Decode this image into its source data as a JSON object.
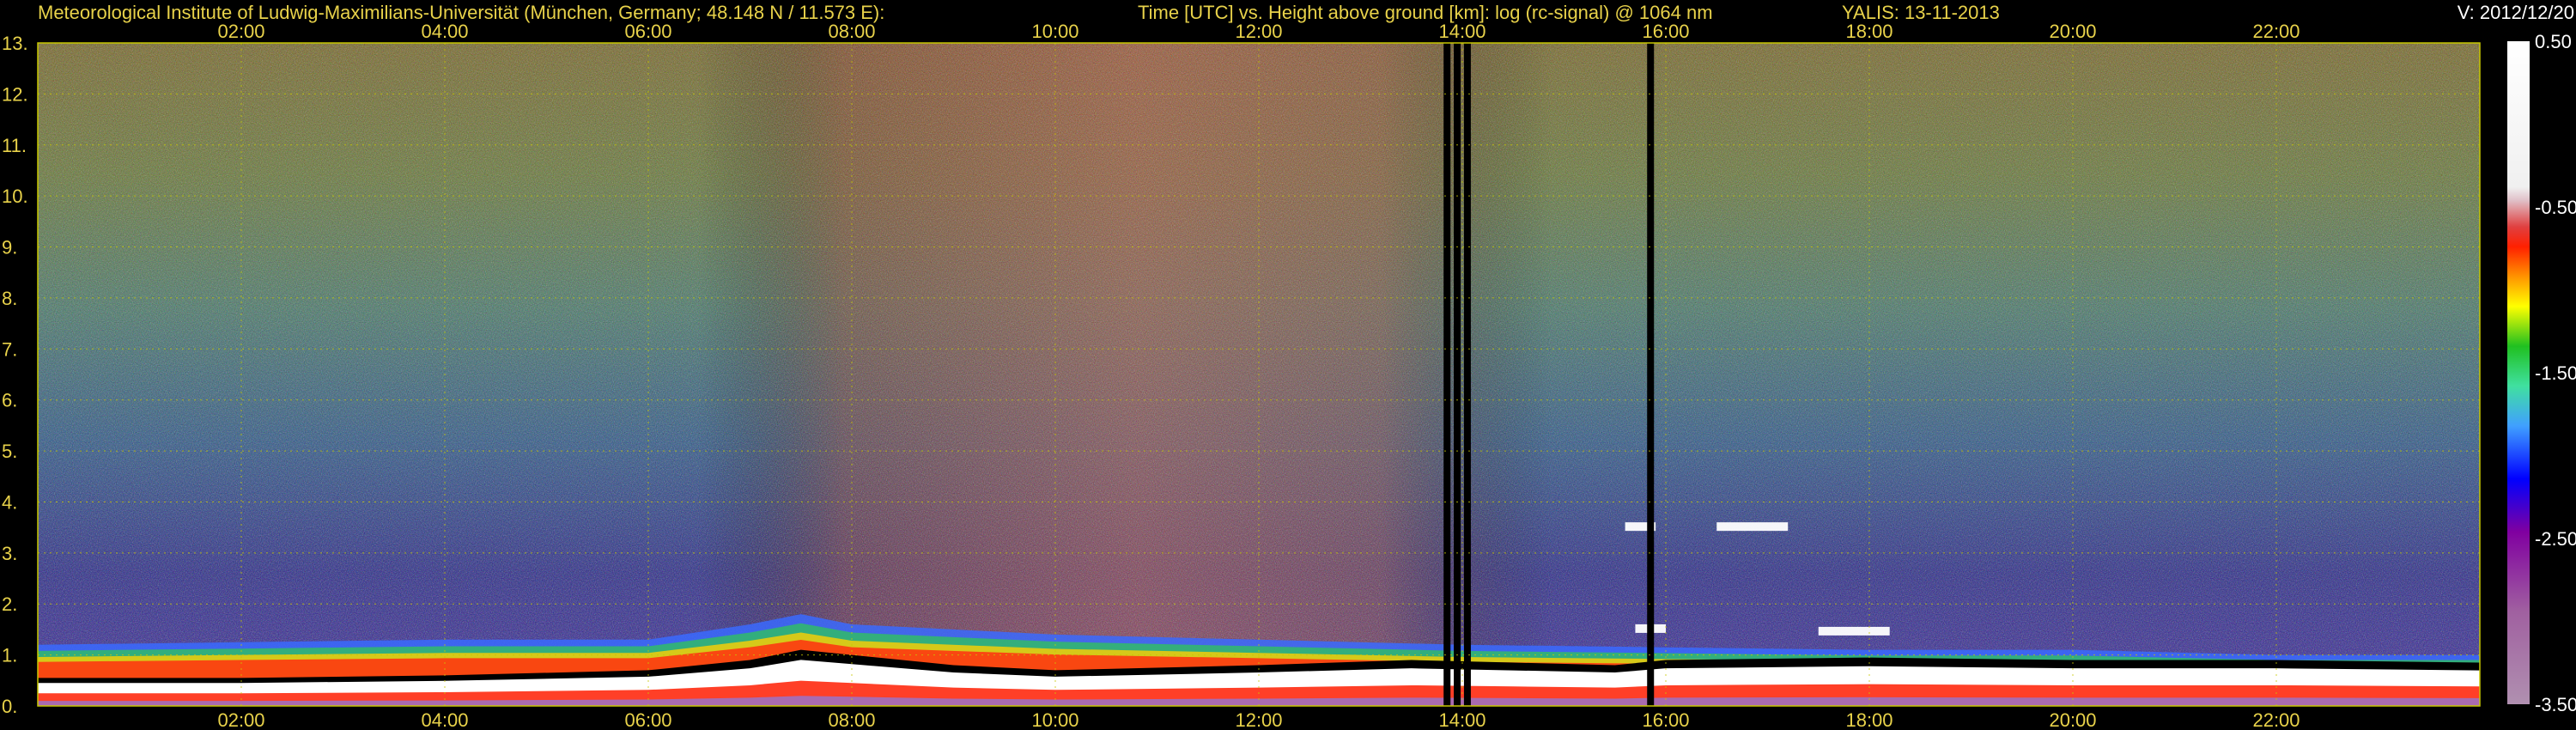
{
  "header": {
    "institute": "Meteorological Institute of Ludwig-Maximilians-Universität (München, Germany; 48.148 N / 11.573 E):",
    "title": "Time [UTC] vs. Height above ground [km]: log (rc-signal) @ 1064 nm",
    "instrument_date": "YALIS: 13-11-2013",
    "version": "V: 2012/12/20"
  },
  "colors": {
    "background": "#000000",
    "text": "#e8d24a",
    "grid": "#c8c800"
  },
  "chart_data": {
    "type": "heatmap",
    "title": "Time [UTC] vs. Height above ground [km]: log (rc-signal) @ 1064 nm",
    "xlabel": "Time [UTC]",
    "ylabel": "Height above ground [km]",
    "x_ticks": [
      "02:00",
      "04:00",
      "06:00",
      "08:00",
      "10:00",
      "12:00",
      "14:00",
      "16:00",
      "18:00",
      "20:00",
      "22:00"
    ],
    "x_tick_hours": [
      2,
      4,
      6,
      8,
      10,
      12,
      14,
      16,
      18,
      20,
      22
    ],
    "xlim": [
      0,
      24
    ],
    "y_ticks": [
      "0.",
      "1.",
      "2.",
      "3.",
      "4.",
      "5.",
      "6.",
      "7.",
      "8.",
      "9.",
      "10.",
      "11.",
      "12.",
      "13."
    ],
    "ylim": [
      0,
      13
    ],
    "grid": true,
    "colorbar": {
      "labels": [
        "0.50",
        "-0.50",
        "-1.50",
        "-2.50",
        "-3.50"
      ],
      "range": [
        -3.5,
        0.5
      ]
    },
    "features": {
      "boundary_layer_top_km": [
        [
          0,
          0.55
        ],
        [
          2,
          0.55
        ],
        [
          4,
          0.6
        ],
        [
          6,
          0.7
        ],
        [
          7,
          0.9
        ],
        [
          7.5,
          1.1
        ],
        [
          8,
          1.0
        ],
        [
          9,
          0.8
        ],
        [
          10,
          0.7
        ],
        [
          12,
          0.8
        ],
        [
          13.5,
          0.9
        ],
        [
          14.5,
          0.85
        ],
        [
          15.5,
          0.8
        ],
        [
          16,
          0.9
        ],
        [
          18,
          0.95
        ],
        [
          20,
          0.9
        ],
        [
          22,
          0.9
        ],
        [
          24,
          0.85
        ]
      ],
      "residual_layer_top_km": [
        [
          0,
          1.2
        ],
        [
          2,
          1.25
        ],
        [
          4,
          1.3
        ],
        [
          6,
          1.3
        ],
        [
          7,
          1.6
        ],
        [
          7.5,
          1.8
        ],
        [
          8,
          1.6
        ],
        [
          10,
          1.4
        ],
        [
          12,
          1.3
        ],
        [
          14,
          1.2
        ],
        [
          16,
          1.15
        ],
        [
          18,
          1.1
        ],
        [
          20,
          1.1
        ],
        [
          22,
          1.0
        ],
        [
          24,
          1.0
        ]
      ],
      "data_gaps_hours": [
        13.85,
        13.95,
        14.05,
        15.85
      ],
      "cloud_patches": [
        {
          "t0": 15.7,
          "t1": 16.0,
          "h": 1.5
        },
        {
          "t0": 17.5,
          "t1": 18.2,
          "h": 1.45
        },
        {
          "t0": 15.6,
          "t1": 15.9,
          "h": 3.5
        },
        {
          "t0": 16.5,
          "t1": 17.2,
          "h": 3.5
        }
      ]
    }
  }
}
